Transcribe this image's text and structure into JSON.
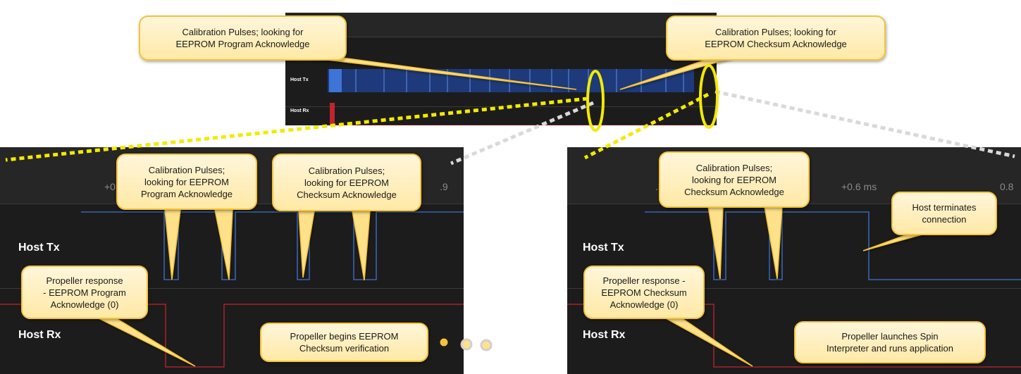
{
  "top_panel": {
    "channels": [
      "Host Tx",
      "Host Rx"
    ],
    "callouts": {
      "program": "Calibration Pulses; looking for\nEEPROM Program Acknowledge",
      "checksum": "Calibration Pulses; looking for\nEEPROM Checksum Acknowledge"
    }
  },
  "left_panel": {
    "ticks": [
      "+0",
      ".9"
    ],
    "channels": [
      "Host Tx",
      "Host Rx"
    ],
    "callouts": {
      "cal_program": "Calibration Pulses;\nlooking for EEPROM\nProgram Acknowledge",
      "cal_checksum": "Calibration Pulses;\nlooking for EEPROM\nChecksum Acknowledge",
      "propeller_response": "Propeller response\n- EEPROM Program\nAcknowledge (0)",
      "begins_checksum": "Propeller begins EEPROM\nChecksum verification"
    }
  },
  "right_panel": {
    "ticks": [
      ".3",
      "+0.6 ms",
      "0.8"
    ],
    "channels": [
      "Host Tx",
      "Host Rx"
    ],
    "callouts": {
      "cal_checksum": "Calibration Pulses;\nlooking for EEPROM\nChecksum Acknowledge",
      "host_terminates": "Host terminates\nconnection",
      "propeller_response": "Propeller response -\nEEPROM Checksum\nAcknowledge (0)",
      "launches_spin": "Propeller launches Spin\nInterpreter and runs application"
    }
  },
  "colors": {
    "tx_wave": "#3d74d6",
    "rx_wave": "#c4232e",
    "highlight": "#f2ea00",
    "callout_border": "#f5c33a"
  }
}
